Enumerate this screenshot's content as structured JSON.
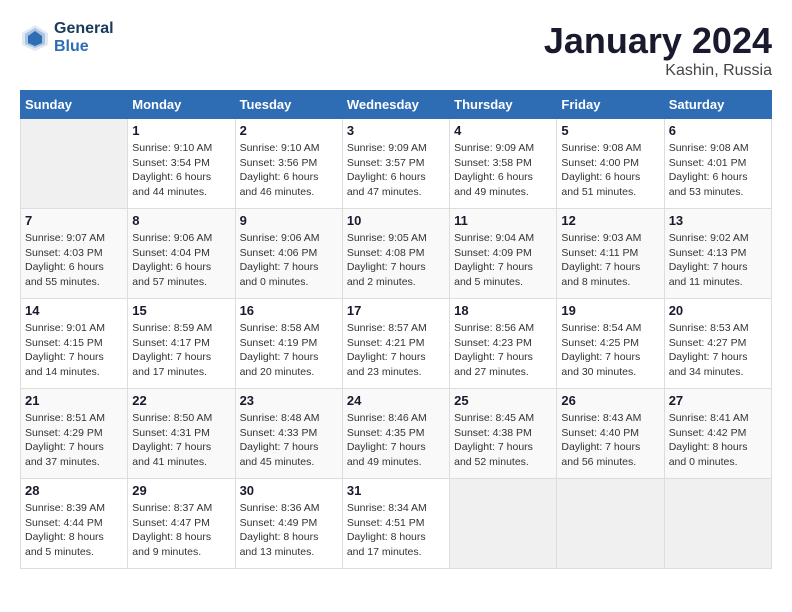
{
  "header": {
    "logo_line1": "General",
    "logo_line2": "Blue",
    "month_year": "January 2024",
    "location": "Kashin, Russia"
  },
  "days_of_week": [
    "Sunday",
    "Monday",
    "Tuesday",
    "Wednesday",
    "Thursday",
    "Friday",
    "Saturday"
  ],
  "weeks": [
    [
      {
        "day": "",
        "info": ""
      },
      {
        "day": "1",
        "info": "Sunrise: 9:10 AM\nSunset: 3:54 PM\nDaylight: 6 hours\nand 44 minutes."
      },
      {
        "day": "2",
        "info": "Sunrise: 9:10 AM\nSunset: 3:56 PM\nDaylight: 6 hours\nand 46 minutes."
      },
      {
        "day": "3",
        "info": "Sunrise: 9:09 AM\nSunset: 3:57 PM\nDaylight: 6 hours\nand 47 minutes."
      },
      {
        "day": "4",
        "info": "Sunrise: 9:09 AM\nSunset: 3:58 PM\nDaylight: 6 hours\nand 49 minutes."
      },
      {
        "day": "5",
        "info": "Sunrise: 9:08 AM\nSunset: 4:00 PM\nDaylight: 6 hours\nand 51 minutes."
      },
      {
        "day": "6",
        "info": "Sunrise: 9:08 AM\nSunset: 4:01 PM\nDaylight: 6 hours\nand 53 minutes."
      }
    ],
    [
      {
        "day": "7",
        "info": "Sunrise: 9:07 AM\nSunset: 4:03 PM\nDaylight: 6 hours\nand 55 minutes."
      },
      {
        "day": "8",
        "info": "Sunrise: 9:06 AM\nSunset: 4:04 PM\nDaylight: 6 hours\nand 57 minutes."
      },
      {
        "day": "9",
        "info": "Sunrise: 9:06 AM\nSunset: 4:06 PM\nDaylight: 7 hours\nand 0 minutes."
      },
      {
        "day": "10",
        "info": "Sunrise: 9:05 AM\nSunset: 4:08 PM\nDaylight: 7 hours\nand 2 minutes."
      },
      {
        "day": "11",
        "info": "Sunrise: 9:04 AM\nSunset: 4:09 PM\nDaylight: 7 hours\nand 5 minutes."
      },
      {
        "day": "12",
        "info": "Sunrise: 9:03 AM\nSunset: 4:11 PM\nDaylight: 7 hours\nand 8 minutes."
      },
      {
        "day": "13",
        "info": "Sunrise: 9:02 AM\nSunset: 4:13 PM\nDaylight: 7 hours\nand 11 minutes."
      }
    ],
    [
      {
        "day": "14",
        "info": "Sunrise: 9:01 AM\nSunset: 4:15 PM\nDaylight: 7 hours\nand 14 minutes."
      },
      {
        "day": "15",
        "info": "Sunrise: 8:59 AM\nSunset: 4:17 PM\nDaylight: 7 hours\nand 17 minutes."
      },
      {
        "day": "16",
        "info": "Sunrise: 8:58 AM\nSunset: 4:19 PM\nDaylight: 7 hours\nand 20 minutes."
      },
      {
        "day": "17",
        "info": "Sunrise: 8:57 AM\nSunset: 4:21 PM\nDaylight: 7 hours\nand 23 minutes."
      },
      {
        "day": "18",
        "info": "Sunrise: 8:56 AM\nSunset: 4:23 PM\nDaylight: 7 hours\nand 27 minutes."
      },
      {
        "day": "19",
        "info": "Sunrise: 8:54 AM\nSunset: 4:25 PM\nDaylight: 7 hours\nand 30 minutes."
      },
      {
        "day": "20",
        "info": "Sunrise: 8:53 AM\nSunset: 4:27 PM\nDaylight: 7 hours\nand 34 minutes."
      }
    ],
    [
      {
        "day": "21",
        "info": "Sunrise: 8:51 AM\nSunset: 4:29 PM\nDaylight: 7 hours\nand 37 minutes."
      },
      {
        "day": "22",
        "info": "Sunrise: 8:50 AM\nSunset: 4:31 PM\nDaylight: 7 hours\nand 41 minutes."
      },
      {
        "day": "23",
        "info": "Sunrise: 8:48 AM\nSunset: 4:33 PM\nDaylight: 7 hours\nand 45 minutes."
      },
      {
        "day": "24",
        "info": "Sunrise: 8:46 AM\nSunset: 4:35 PM\nDaylight: 7 hours\nand 49 minutes."
      },
      {
        "day": "25",
        "info": "Sunrise: 8:45 AM\nSunset: 4:38 PM\nDaylight: 7 hours\nand 52 minutes."
      },
      {
        "day": "26",
        "info": "Sunrise: 8:43 AM\nSunset: 4:40 PM\nDaylight: 7 hours\nand 56 minutes."
      },
      {
        "day": "27",
        "info": "Sunrise: 8:41 AM\nSunset: 4:42 PM\nDaylight: 8 hours\nand 0 minutes."
      }
    ],
    [
      {
        "day": "28",
        "info": "Sunrise: 8:39 AM\nSunset: 4:44 PM\nDaylight: 8 hours\nand 5 minutes."
      },
      {
        "day": "29",
        "info": "Sunrise: 8:37 AM\nSunset: 4:47 PM\nDaylight: 8 hours\nand 9 minutes."
      },
      {
        "day": "30",
        "info": "Sunrise: 8:36 AM\nSunset: 4:49 PM\nDaylight: 8 hours\nand 13 minutes."
      },
      {
        "day": "31",
        "info": "Sunrise: 8:34 AM\nSunset: 4:51 PM\nDaylight: 8 hours\nand 17 minutes."
      },
      {
        "day": "",
        "info": ""
      },
      {
        "day": "",
        "info": ""
      },
      {
        "day": "",
        "info": ""
      }
    ]
  ]
}
